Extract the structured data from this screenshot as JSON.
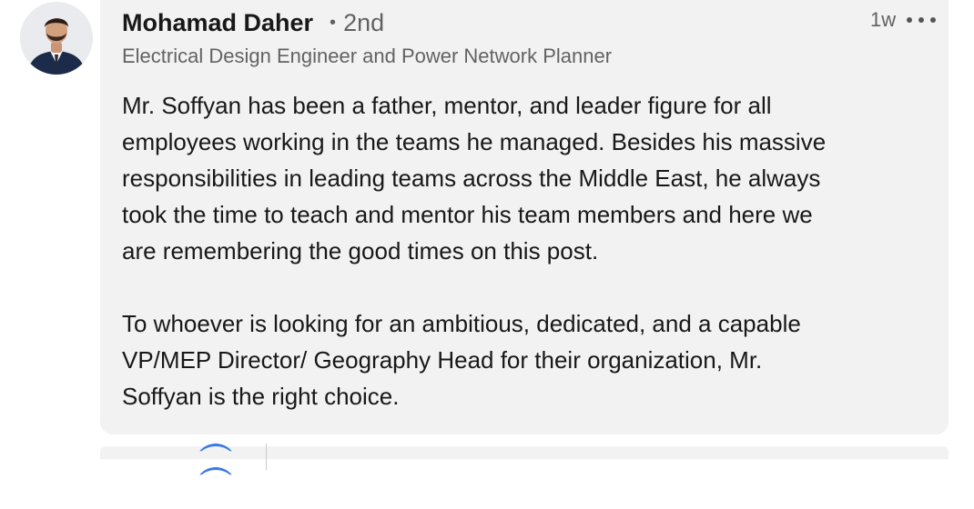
{
  "comment": {
    "author": {
      "name": "Mohamad Daher",
      "degree_separator": "•",
      "degree": "2nd",
      "headline": "Electrical Design Engineer and Power Network Planner",
      "avatar_icon": "profile-photo"
    },
    "timestamp": "1w",
    "more_icon": "ellipsis-icon",
    "paragraphs": [
      [
        "Mr. Soffyan has been a father, mentor, and leader figure for all",
        "employees working in the teams he managed. Besides his massive",
        "responsibilities in leading teams across the Middle East, he always",
        "took the time to teach and mentor his team members and here we",
        "are remembering the good times on this post."
      ],
      [
        "To whoever is looking for an ambitious, dedicated, and a capable",
        "VP/MEP Director/ Geography Head for their organization, Mr.",
        "Soffyan is the right choice."
      ]
    ]
  },
  "colors": {
    "bubble_bg": "#f2f2f2",
    "text_primary": "rgba(0,0,0,0.9)",
    "text_secondary": "rgba(0,0,0,0.6)",
    "accent": "#3b7ae0"
  }
}
